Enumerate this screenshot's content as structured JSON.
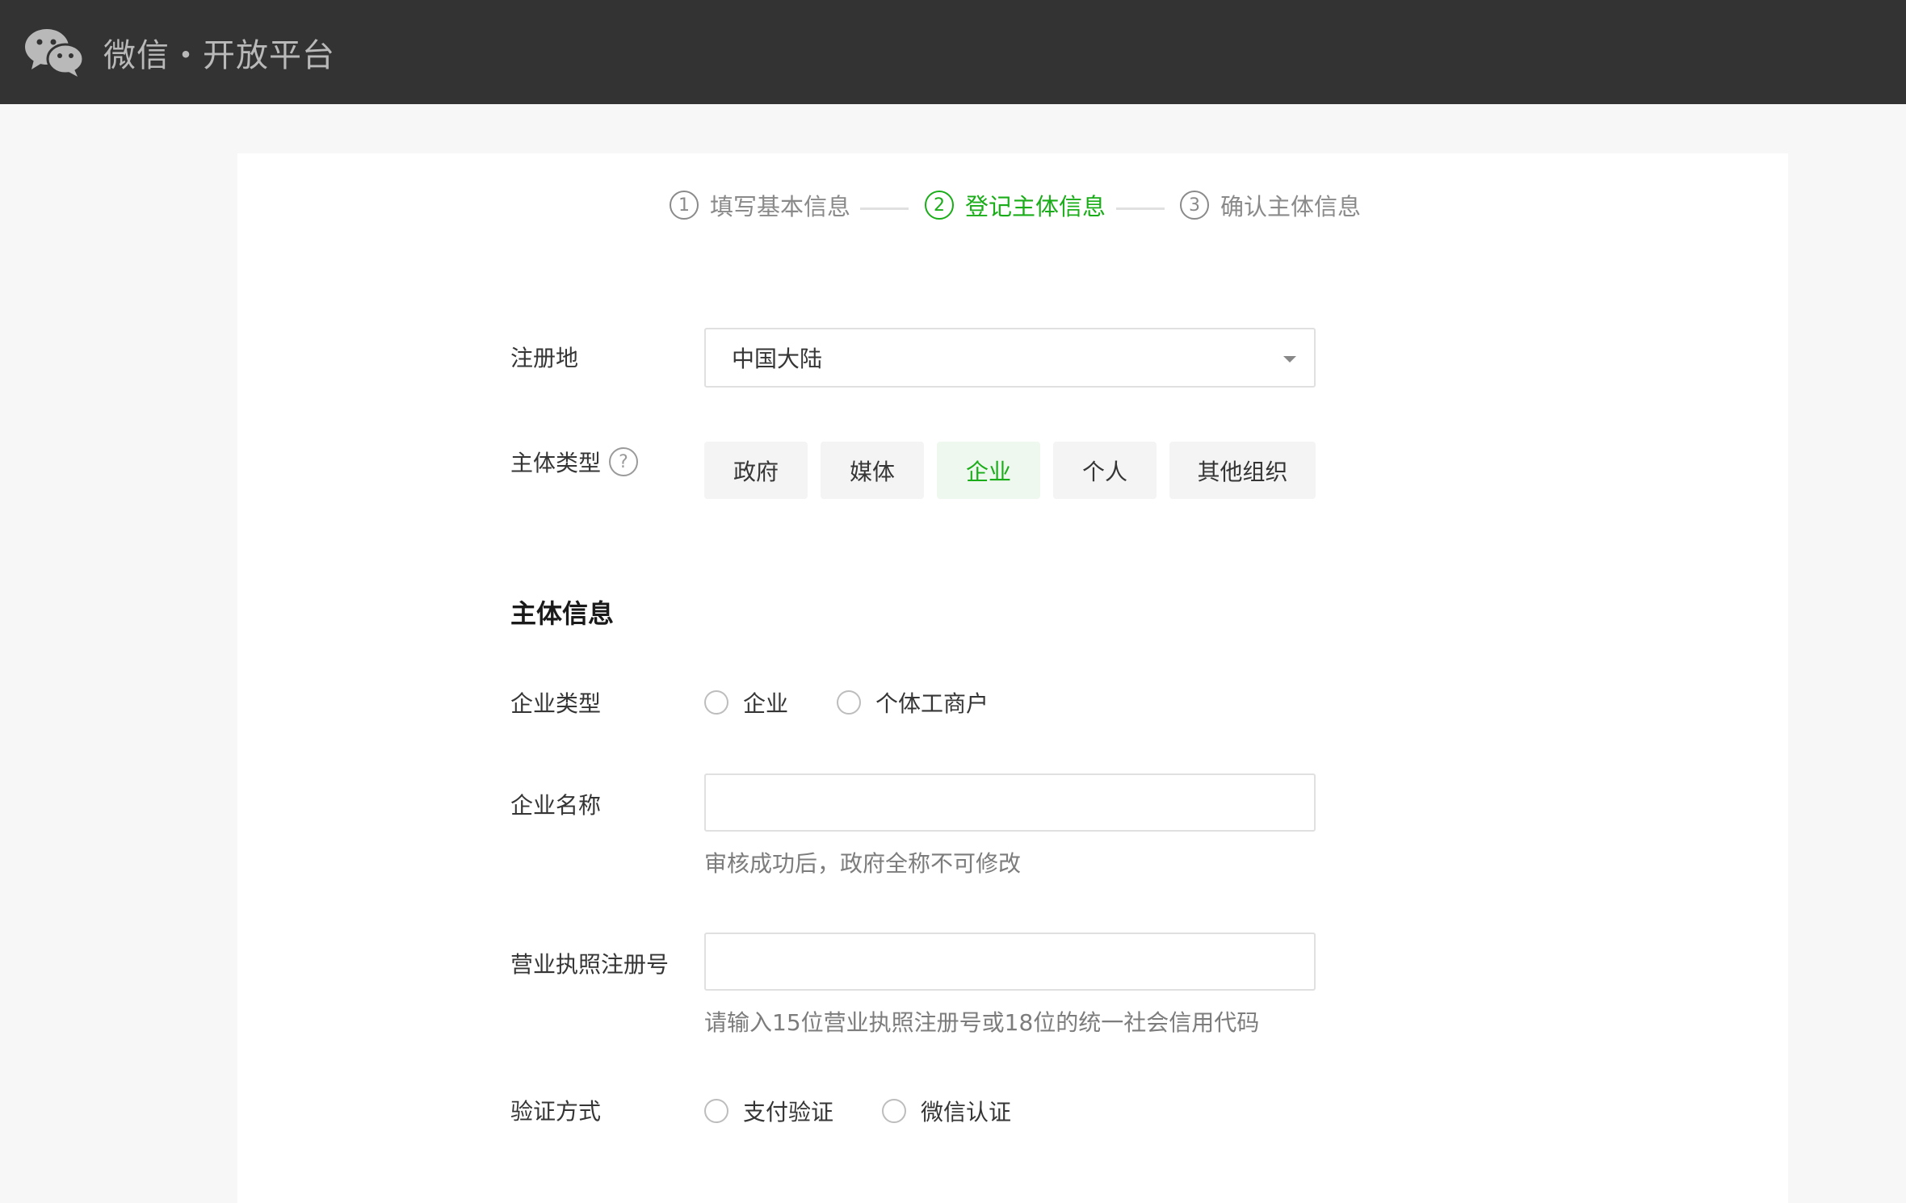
{
  "header": {
    "title": "微信・开放平台",
    "logo_icon": "wechat-logo-icon"
  },
  "steps": [
    {
      "number": "1",
      "label": "填写基本信息",
      "state": "done"
    },
    {
      "number": "2",
      "label": "登记主体信息",
      "state": "active"
    },
    {
      "number": "3",
      "label": "确认主体信息",
      "state": "pending"
    }
  ],
  "colors": {
    "accent": "#1aad19",
    "header_bg": "#333333",
    "page_bg": "#f7f7f7"
  },
  "form": {
    "region": {
      "label": "注册地",
      "value": "中国大陆"
    },
    "entity_type": {
      "label": "主体类型",
      "help_icon": "question-mark-icon",
      "options": [
        "政府",
        "媒体",
        "企业",
        "个人",
        "其他组织"
      ],
      "selected": "企业"
    },
    "section_title": "主体信息",
    "company_type": {
      "label": "企业类型",
      "options": [
        "企业",
        "个体工商户"
      ]
    },
    "company_name": {
      "label": "企业名称",
      "value": "",
      "hint": "审核成功后，政府全称不可修改"
    },
    "license_number": {
      "label": "营业执照注册号",
      "value": "",
      "hint": "请输入15位营业执照注册号或18位的统一社会信用代码"
    },
    "verification": {
      "label": "验证方式",
      "options": [
        "支付验证",
        "微信认证"
      ]
    }
  }
}
